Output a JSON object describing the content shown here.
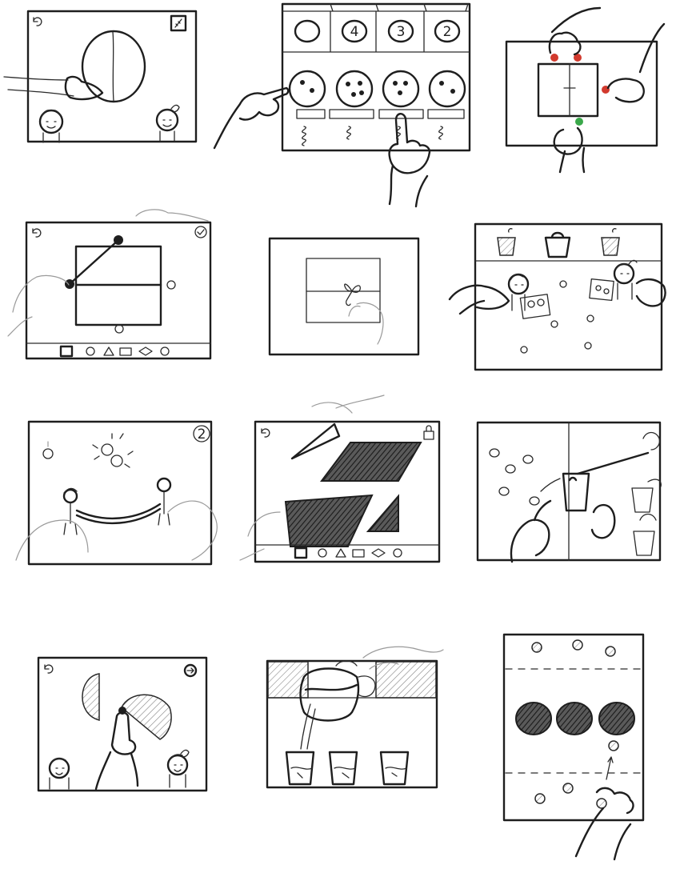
{
  "panels": [
    {
      "id": "panel-1",
      "icons": [
        "undo-icon",
        "ruler-icon"
      ]
    },
    {
      "id": "panel-2",
      "counter_values": [
        "2",
        "4",
        "3",
        "2"
      ]
    },
    {
      "id": "panel-3"
    },
    {
      "id": "panel-4",
      "icons": [
        "undo-icon",
        "checkmark-icon"
      ],
      "shape_toolbar": [
        "square",
        "circle",
        "triangle",
        "rectangle",
        "diamond",
        "circle"
      ]
    },
    {
      "id": "panel-5"
    },
    {
      "id": "panel-6"
    },
    {
      "id": "panel-7",
      "round_number": "2"
    },
    {
      "id": "panel-8",
      "icons": [
        "undo-icon",
        "lock-icon"
      ],
      "shape_toolbar": [
        "square",
        "circle",
        "triangle",
        "rectangle",
        "diamond",
        "circle"
      ]
    },
    {
      "id": "panel-9"
    },
    {
      "id": "panel-10",
      "icons": [
        "undo-icon",
        "next-arrow-icon"
      ]
    },
    {
      "id": "panel-11"
    },
    {
      "id": "panel-12"
    }
  ],
  "colors": {
    "ink": "#1e1e1e",
    "red_marker": "#d23a2e",
    "green_marker": "#3aa84a",
    "paper": "#ffffff"
  }
}
